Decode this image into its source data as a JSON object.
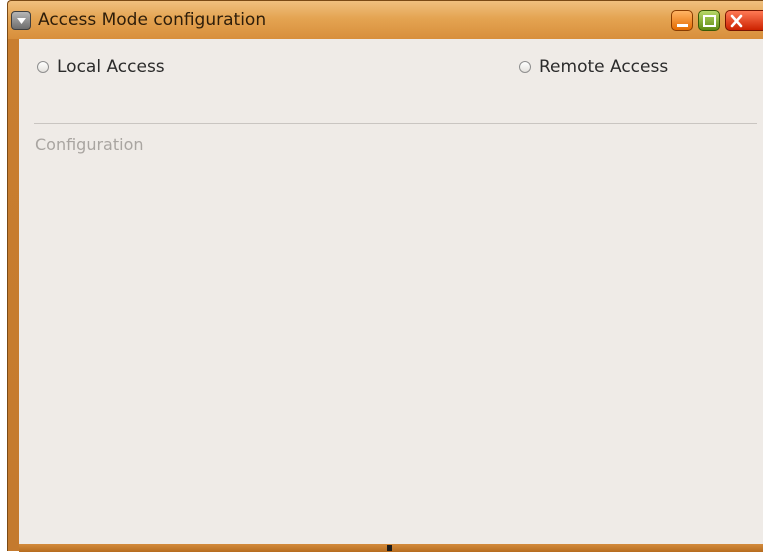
{
  "window": {
    "title": "Access Mode configuration",
    "accent_color": "#d88f3b"
  },
  "titlebar_buttons": {
    "menu_icon": "chevron-down-icon",
    "minimize_icon": "minimize-icon",
    "maximize_icon": "maximize-icon",
    "close_icon": "close-icon"
  },
  "access_mode": {
    "options": [
      {
        "label": "Local Access",
        "selected": false
      },
      {
        "label": "Remote Access",
        "selected": false
      }
    ]
  },
  "configuration": {
    "label": "Configuration"
  }
}
